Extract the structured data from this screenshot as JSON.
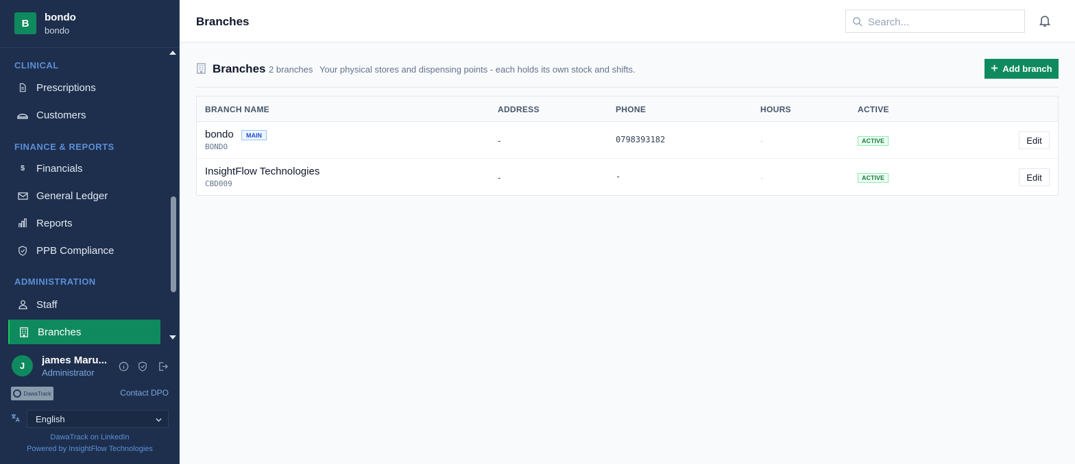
{
  "brand": {
    "badge": "B",
    "name": "bondo",
    "sub": "bondo"
  },
  "sidebar": {
    "sections": [
      {
        "label": "CLINICAL"
      },
      {
        "label": "FINANCE & REPORTS"
      },
      {
        "label": "ADMINISTRATION"
      }
    ],
    "items": [
      {
        "label": "Prescriptions",
        "icon": "document-icon"
      },
      {
        "label": "Customers",
        "icon": "customers-icon"
      },
      {
        "label": "Financials",
        "icon": "dollar-icon"
      },
      {
        "label": "General Ledger",
        "icon": "ledger-icon"
      },
      {
        "label": "Reports",
        "icon": "bar-chart-icon"
      },
      {
        "label": "PPB Compliance",
        "icon": "shield-check-icon"
      },
      {
        "label": "Staff",
        "icon": "users-icon"
      },
      {
        "label": "Branches",
        "icon": "building-icon",
        "active": true
      }
    ]
  },
  "user": {
    "initial": "J",
    "name": "james Maru...",
    "role": "Administrator"
  },
  "footer": {
    "logo_text": "DawaTrack",
    "contact": "Contact DPO",
    "language": "English",
    "linkedin": "DawaTrack on LinkedIn",
    "powered": "Powered by InsightFlow Technologies"
  },
  "topbar": {
    "title": "Branches",
    "search_placeholder": "Search..."
  },
  "content": {
    "title": "Branches",
    "count": "2 branches",
    "description": "Your physical stores and dispensing points - each holds its own stock and shifts.",
    "add_button": "Add branch"
  },
  "table": {
    "columns": [
      "BRANCH NAME",
      "ADDRESS",
      "PHONE",
      "HOURS",
      "ACTIVE"
    ],
    "rows": [
      {
        "name": "bondo",
        "badge": "MAIN",
        "code": "BONDO",
        "address": "-",
        "phone": "0798393182",
        "hours": "-",
        "status": "ACTIVE",
        "action": "Edit"
      },
      {
        "name": "InsightFlow Technologies",
        "code": "CBD009",
        "address": "-",
        "phone": "-",
        "hours": "-",
        "status": "ACTIVE",
        "action": "Edit"
      }
    ]
  },
  "colors": {
    "sidebar_bg": "#1e2f4d",
    "accent": "#0f8a5f",
    "section_label": "#5b8fd8"
  }
}
